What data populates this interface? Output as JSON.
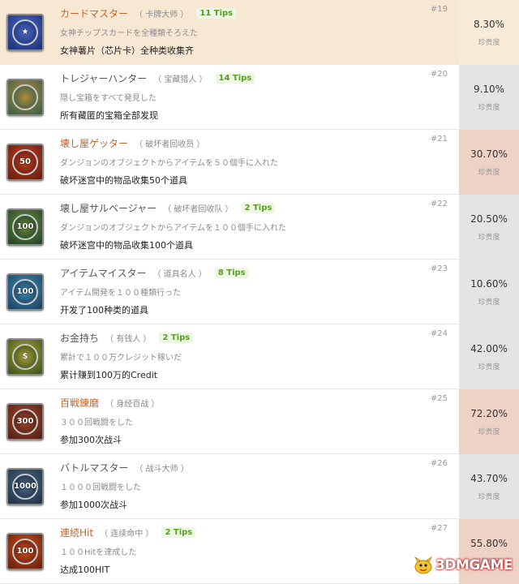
{
  "colors": {
    "row_highlight_bg": "#f7e8d4",
    "rarity_bg_default": "#e4e4e4",
    "rarity_bg_rare": "#eed2c6",
    "rarity_bg_top": "#f8ebd8",
    "tips_text": "#5b9b2a",
    "title_highlight": "#c0642f"
  },
  "achievements": [
    {
      "icon": "card-master-badge-icon",
      "icon_text": "★",
      "icon_colors": [
        "#1a2a6a",
        "#4a6ac8"
      ],
      "rank": "#19",
      "title": "カードマスター",
      "highlight": true,
      "alias": "（ 卡牌大师 ）",
      "tips": "11 Tips",
      "desc_ja": "女神チップスカードを全種類そろえた",
      "desc_zh": "女神薯片（芯片卡）全种类收集齐",
      "rarity": "8.30%",
      "rarity_label": "珍贵度",
      "rarity_tier": "top"
    },
    {
      "icon": "treasure-hunter-badge-icon",
      "icon_text": "",
      "icon_colors": [
        "#2e5a4a",
        "#b08a3a"
      ],
      "rank": "#20",
      "title": "トレジャーハンター",
      "highlight": false,
      "alias": "（ 宝藏猎人 ）",
      "tips": "14 Tips",
      "desc_ja": "隠し宝箱をすべて発見した",
      "desc_zh": "所有藏匿的宝箱全部发现",
      "rarity": "9.10%",
      "rarity_label": "珍贵度",
      "rarity_tier": "default"
    },
    {
      "icon": "destruction-getter-50-badge-icon",
      "icon_text": "50",
      "icon_colors": [
        "#5a1a10",
        "#c04020"
      ],
      "rank": "#21",
      "title": "壊し屋ゲッター",
      "highlight": true,
      "alias": "（ 破坏者回收员 ）",
      "tips": "",
      "desc_ja": "ダンジョンのオブジェクトからアイテムを５０個手に入れた",
      "desc_zh": "破坏迷宫中的物品收集50个道具",
      "rarity": "30.70%",
      "rarity_label": "珍贵度",
      "rarity_tier": "rare"
    },
    {
      "icon": "destruction-salvager-100-badge-icon",
      "icon_text": "100",
      "icon_colors": [
        "#1a3a2a",
        "#6a8a3a"
      ],
      "rank": "#22",
      "title": "壊し屋サルベージャー",
      "highlight": false,
      "alias": "（ 破坏者回收队 ）",
      "tips": "2 Tips",
      "desc_ja": "ダンジョンのオブジェクトからアイテムを１００個手に入れた",
      "desc_zh": "破坏迷宫中的物品收集100个道具",
      "rarity": "20.50%",
      "rarity_label": "珍贵度",
      "rarity_tier": "default"
    },
    {
      "icon": "item-master-100-badge-icon",
      "icon_text": "100",
      "icon_colors": [
        "#1a3a5a",
        "#3a8ab0"
      ],
      "rank": "#23",
      "title": "アイテムマイスター",
      "highlight": false,
      "alias": "（ 道具名人 ）",
      "tips": "8 Tips",
      "desc_ja": "アイテム開発を１００種類行った",
      "desc_zh": "开发了100种类的道具",
      "rarity": "10.60%",
      "rarity_label": "珍贵度",
      "rarity_tier": "default"
    },
    {
      "icon": "millionaire-badge-icon",
      "icon_text": "$",
      "icon_colors": [
        "#2a4a1a",
        "#b0a03a"
      ],
      "rank": "#24",
      "title": "お金持ち",
      "highlight": false,
      "alias": "（ 有钱人 ）",
      "tips": "2 Tips",
      "desc_ja": "累計で１００万クレジット稼いだ",
      "desc_zh": "累计赚到100万的Credit",
      "rarity": "42.00%",
      "rarity_label": "珍贵度",
      "rarity_tier": "default"
    },
    {
      "icon": "battle-300-badge-icon",
      "icon_text": "300",
      "icon_colors": [
        "#4a1a10",
        "#a04a30"
      ],
      "rank": "#25",
      "title": "百戦錬磨",
      "highlight": true,
      "alias": "（ 身经百战 ）",
      "tips": "",
      "desc_ja": "３００回戦闘をした",
      "desc_zh": "参加300次战斗",
      "rarity": "72.20%",
      "rarity_label": "珍贵度",
      "rarity_tier": "rare"
    },
    {
      "icon": "battle-1000-badge-icon",
      "icon_text": "1000",
      "icon_colors": [
        "#1a2a3a",
        "#4a6a8a"
      ],
      "rank": "#26",
      "title": "バトルマスター",
      "highlight": false,
      "alias": "（ 战斗大师 ）",
      "tips": "",
      "desc_ja": "１０００回戦闘をした",
      "desc_zh": "参加1000次战斗",
      "rarity": "43.70%",
      "rarity_label": "珍贵度",
      "rarity_tier": "default"
    },
    {
      "icon": "combo-hit-100-badge-icon",
      "icon_text": "100",
      "icon_colors": [
        "#5a1a0a",
        "#d05020"
      ],
      "rank": "#27",
      "title": "連続Hit",
      "highlight": true,
      "alias": "（ 连续命中 ）",
      "tips": "2 Tips",
      "desc_ja": "１００Hitを達成した",
      "desc_zh": "达成100HIT",
      "rarity": "55.80%",
      "rarity_label": "珍贵度",
      "rarity_tier": "rare"
    }
  ],
  "watermark": {
    "text": "3DMGAME",
    "icon": "mascot-logo-icon"
  }
}
